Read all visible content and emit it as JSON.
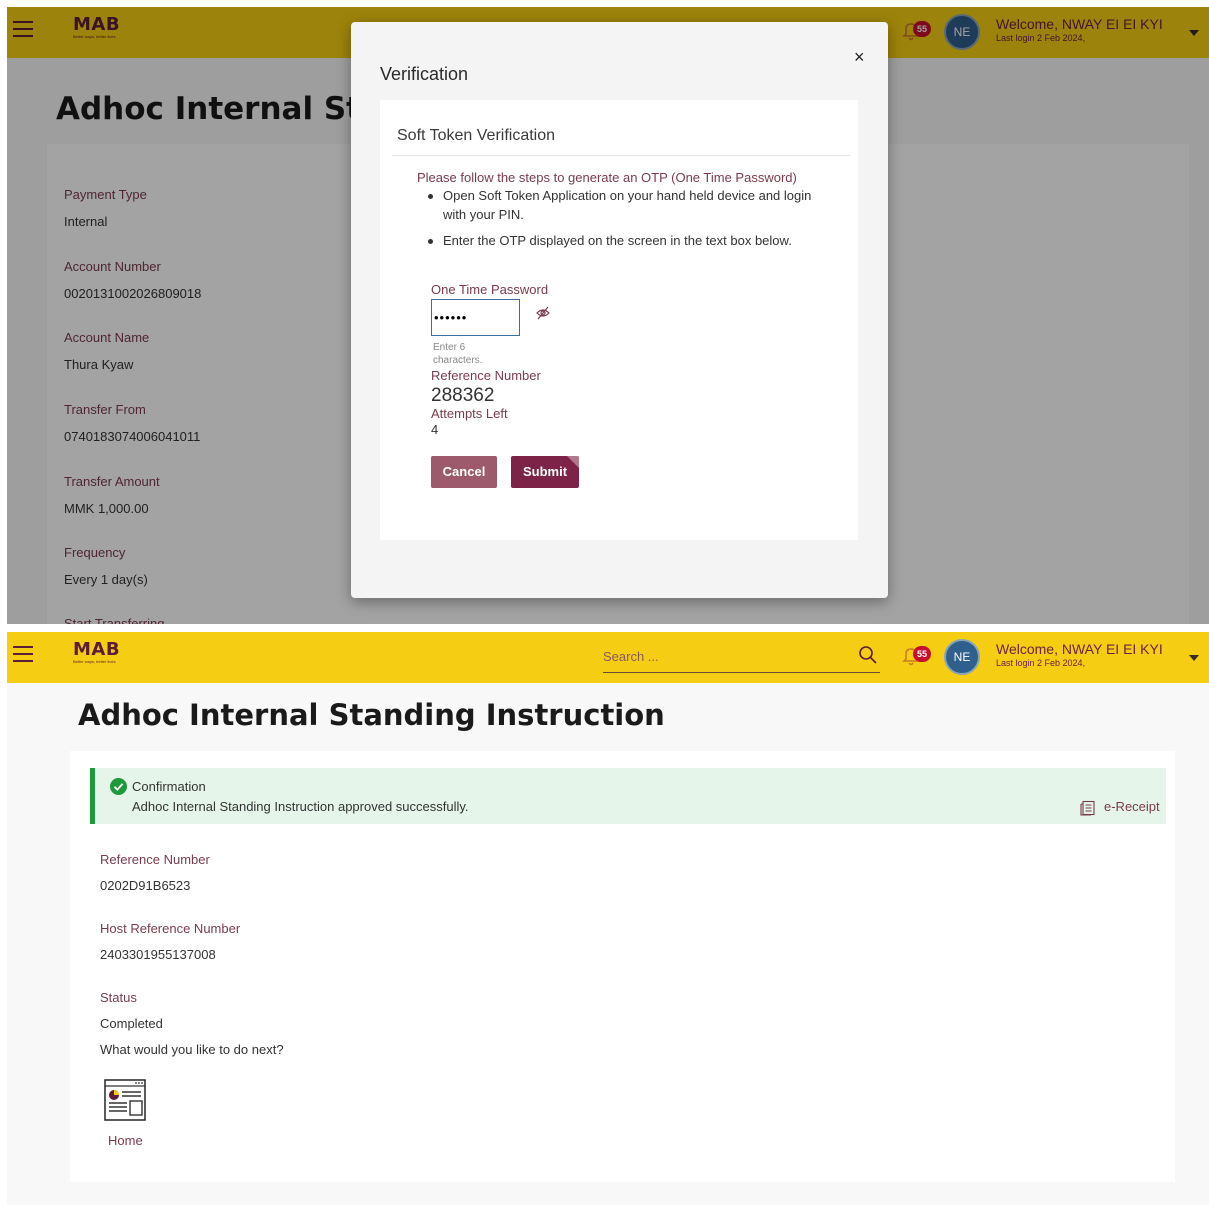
{
  "header": {
    "logo": "MAB",
    "logo_tagline": "Better ways, better lives",
    "search_placeholder": "Search ...",
    "notification_count": "55",
    "avatar_initials": "NE",
    "welcome": "Welcome, NWAY EI EI KYI",
    "last_login": "Last login 2 Feb 2024,"
  },
  "top_screen": {
    "page_title": "Adhoc Internal Sta",
    "details": [
      {
        "label": "Payment Type",
        "value": "Internal"
      },
      {
        "label": "Account Number",
        "value": "0020131002026809018"
      },
      {
        "label": "Account Name",
        "value": "Thura Kyaw"
      },
      {
        "label": "Transfer From",
        "value": "0740183074006041011"
      },
      {
        "label": "Transfer Amount",
        "value": "MMK 1,000.00"
      },
      {
        "label": "Frequency",
        "value": "Every 1 day(s)"
      },
      {
        "label": "Start Transferring",
        "value": ""
      }
    ]
  },
  "modal": {
    "title": "Verification",
    "close": "×",
    "section_title": "Soft Token Verification",
    "steps_intro": "Please follow the steps to generate an OTP (One Time Password)",
    "steps": [
      "Open Soft Token Application on your hand held device and login with your PIN.",
      "Enter the OTP displayed on the screen in the text box below."
    ],
    "otp_label": "One Time Password",
    "otp_value": "••••••",
    "otp_hint": "Enter 6 characters.",
    "reference_label": "Reference Number",
    "reference_value": "288362",
    "attempts_label": "Attempts Left",
    "attempts_value": "4",
    "cancel_label": "Cancel",
    "submit_label": "Submit"
  },
  "bottom_screen": {
    "page_title": "Adhoc Internal Standing Instruction",
    "confirmation": {
      "title": "Confirmation",
      "message": "Adhoc Internal Standing Instruction approved successfully.",
      "receipt_label": "e-Receipt"
    },
    "details": [
      {
        "label": "Reference Number",
        "value": "0202D91B6523"
      },
      {
        "label": "Host Reference Number",
        "value": "2403301955137008"
      },
      {
        "label": "Status",
        "value": "Completed"
      }
    ],
    "next_question": "What would you like to do next?",
    "home_label": "Home"
  },
  "colors": {
    "header": "#f5cd12",
    "brand": "#5b1d37",
    "label": "#7a3b4d",
    "submit": "#7d2347",
    "cancel": "#9c5a6c",
    "success": "#1e9a3c"
  },
  "icons": [
    "hamburger-icon",
    "search-icon",
    "bell-icon",
    "eye-slash-icon",
    "close-icon",
    "check-circle-icon",
    "receipt-icon",
    "dashboard-icon",
    "caret-down-icon"
  ]
}
